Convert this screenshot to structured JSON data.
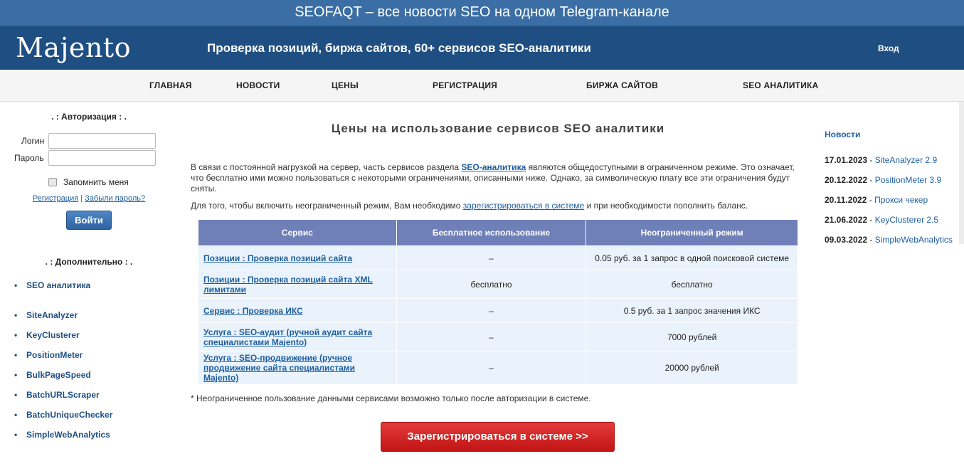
{
  "topbar": {
    "text": "SEOFAQT – все новости SEO на одном Telegram-канале"
  },
  "header": {
    "logo": "Majento",
    "tagline": "Проверка позиций, биржа сайтов, 60+ сервисов SEO-аналитики",
    "login_link": "Вход"
  },
  "nav": [
    "ГЛАВНАЯ",
    "НОВОСТИ",
    "ЦЕНЫ",
    "РЕГИСТРАЦИЯ",
    "БИРЖА САЙТОВ",
    "SEO АНАЛИТИКА"
  ],
  "auth": {
    "title": ". : Авторизация : .",
    "login_label": "Логин",
    "password_label": "Пароль",
    "login_value": "",
    "password_value": "",
    "remember_label": "Запомнить меня",
    "register_link": "Регистрация",
    "forgot_link": "Забыли пароль?",
    "separator": "|",
    "submit": "Войти"
  },
  "extra": {
    "title": ". : Дополнительно : .",
    "items": [
      "SEO аналитика",
      "SiteAnalyzer",
      "KeyClusterer",
      "PositionMeter",
      "BulkPageSpeed",
      "BatchURLScraper",
      "BatchUniqueChecker",
      "SimpleWebAnalytics"
    ]
  },
  "main": {
    "title": "Цены на использование сервисов SEO аналитики",
    "para1_prefix": "В связи с постоянной нагрузкой на сервер, часть сервисов раздела ",
    "para1_link": "SEO-аналитика",
    "para1_suffix": " являются общедоступными в ограниченном режиме. Это означает, что бесплатно ими можно пользоваться с некоторыми ограничениями, описанными ниже. Однако, за символическую плату все эти ограничения будут сняты.",
    "para2_prefix": "Для того, чтобы включить неограниченный режим, Вам необходимо ",
    "para2_link": "зарегистрироваться в системе",
    "para2_suffix": " и при необходимости пополнить баланс.",
    "table": {
      "headers": [
        "Сервис",
        "Бесплатное использование",
        "Неограниченный режим"
      ],
      "rows": [
        {
          "service": "Позиции : Проверка позиций сайта",
          "free": "–",
          "unlimited": "0.05 руб. за 1 запрос в одной поисковой системе"
        },
        {
          "service": "Позиции : Проверка позиций сайта XML лимитами",
          "free": "бесплатно",
          "unlimited": "бесплатно"
        },
        {
          "service": "Сервис : Проверка ИКС",
          "free": "–",
          "unlimited": "0.5 руб. за 1 запрос значения ИКС"
        },
        {
          "service": "Услуга : SEO-аудит (ручной аудит сайта специалистами Majento)",
          "free": "–",
          "unlimited": "7000 рублей"
        },
        {
          "service": "Услуга : SEO-продвижение (ручное продвижение сайта специалистами Majento)",
          "free": "–",
          "unlimited": "20000 рублей"
        }
      ]
    },
    "note": "* Неограниченное пользование данными сервисами возможно только после авторизации в системе.",
    "register_button": "Зарегистрироваться в системе >>"
  },
  "news": {
    "title": "Новости",
    "items": [
      {
        "date": "17.01.2023",
        "name": "SiteAnalyzer 2.9"
      },
      {
        "date": "20.12.2022",
        "name": "PositionMeter 3.9"
      },
      {
        "date": "20.11.2022",
        "name": "Прокси чекер"
      },
      {
        "date": "21.06.2022",
        "name": "KeyClusterer 2.5"
      },
      {
        "date": "09.03.2022",
        "name": "SimpleWebAnalytics"
      }
    ],
    "separator": " - "
  },
  "colors": {
    "topbar": "#3a6ea5",
    "header": "#1f4f82",
    "table_header": "#6f7fb8",
    "table_cell": "#eaf3fb",
    "link": "#1f5fa0",
    "register_button": "#d42424"
  }
}
